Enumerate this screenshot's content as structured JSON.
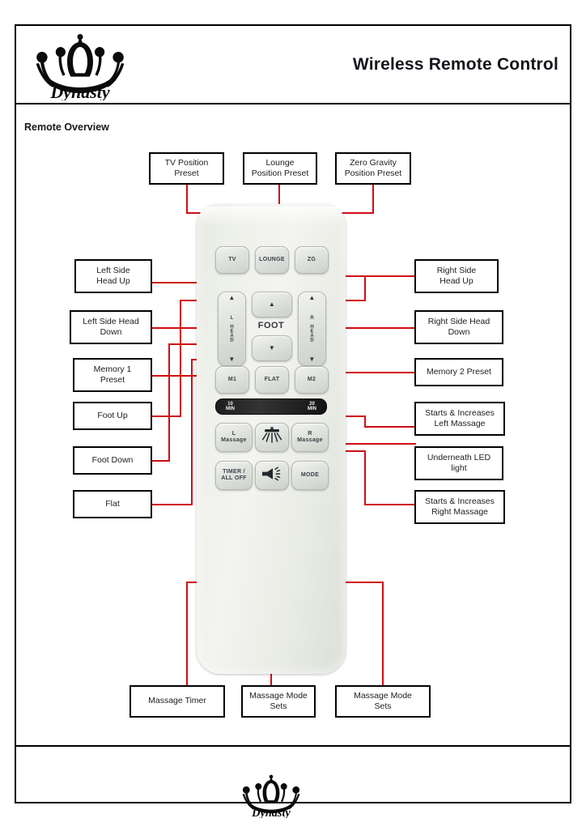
{
  "header": {
    "title": "Wireless Remote Control",
    "logo_name": "dynasty-crown-logo"
  },
  "section": {
    "title": "Remote Overview"
  },
  "remote": {
    "logo_name": "dynasty-crown-logo",
    "timer_strip": {
      "left_label": "10\nMIN",
      "right_label": "20\nMIN"
    },
    "center_label": "FOOT",
    "buttons": [
      {
        "id": "tv",
        "label": "TV"
      },
      {
        "id": "lounge",
        "label": "LOUNGE"
      },
      {
        "id": "zg",
        "label": "ZG"
      },
      {
        "id": "l-head",
        "label": "L HEAD",
        "up": "▲",
        "down": "▼"
      },
      {
        "id": "foot-up",
        "label": "▲"
      },
      {
        "id": "foot-down",
        "label": "▼"
      },
      {
        "id": "r-head",
        "label": "R HEAD",
        "up": "▲",
        "down": "▼"
      },
      {
        "id": "m1",
        "label": "M1"
      },
      {
        "id": "flat",
        "label": "FLAT"
      },
      {
        "id": "m2",
        "label": "M2"
      },
      {
        "id": "l-massage",
        "label": "L\nMassage"
      },
      {
        "id": "led-light",
        "label": ""
      },
      {
        "id": "r-massage",
        "label": "R\nMassage"
      },
      {
        "id": "timer-alloff",
        "label": "TIMER /\nALL OFF"
      },
      {
        "id": "speaker",
        "label": ""
      },
      {
        "id": "mode",
        "label": "MODE"
      }
    ]
  },
  "callouts": {
    "top": [
      {
        "id": "tv-position-preset",
        "text": "TV Position\nPreset"
      },
      {
        "id": "lounge-position-preset",
        "text": "Lounge\nPosition Preset"
      },
      {
        "id": "zero-gravity-position-preset",
        "text": "Zero Gravity\nPosition Preset"
      }
    ],
    "left": [
      {
        "id": "left-side-head-up",
        "text": "Left Side\nHead Up"
      },
      {
        "id": "left-side-head-down",
        "text": "Left Side Head\nDown"
      },
      {
        "id": "memory-1-preset",
        "text": "Memory 1\nPreset"
      },
      {
        "id": "foot-up",
        "text": "Foot Up"
      },
      {
        "id": "foot-down",
        "text": "Foot Down"
      },
      {
        "id": "flat",
        "text": "Flat"
      }
    ],
    "right": [
      {
        "id": "right-side-head-up",
        "text": "Right Side\nHead Up"
      },
      {
        "id": "right-side-head-down",
        "text": "Right Side Head\nDown"
      },
      {
        "id": "memory-2-preset",
        "text": "Memory 2 Preset"
      },
      {
        "id": "starts-increases-left-massage",
        "text": "Starts & Increases\nLeft Massage"
      },
      {
        "id": "underneath-led-light",
        "text": "Underneath LED\nlight"
      },
      {
        "id": "starts-increases-right-massage",
        "text": "Starts & Increases\nRight Massage"
      }
    ],
    "bottom": [
      {
        "id": "massage-timer",
        "text": "Massage Timer"
      },
      {
        "id": "massage-mode-sets-1",
        "text": "Massage Mode\nSets"
      },
      {
        "id": "massage-mode-sets-2",
        "text": "Massage Mode\nSets"
      }
    ]
  },
  "colors": {
    "callout_line": "#cf0d12",
    "border": "#000000",
    "text": "#1b1d22"
  }
}
